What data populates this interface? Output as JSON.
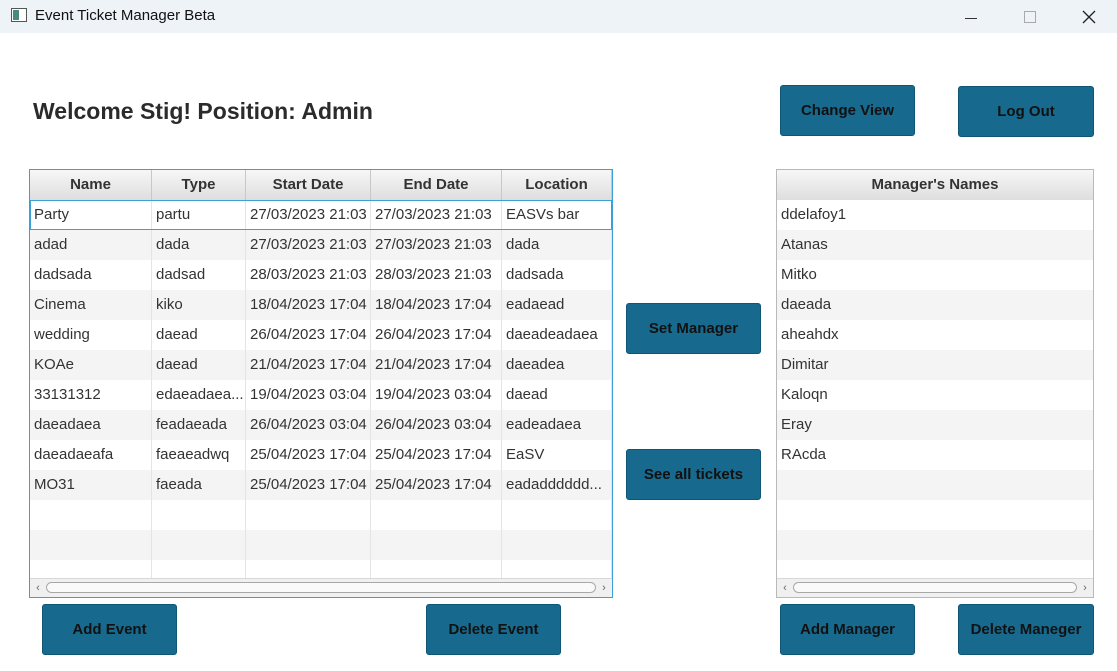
{
  "window": {
    "title": "Event Ticket Manager Beta"
  },
  "header": {
    "welcome": "Welcome Stig! Position: Admin"
  },
  "buttons": {
    "change_view": "Change View",
    "log_out": "Log Out",
    "set_manager": "Set Manager",
    "see_all_tickets": "See all tickets",
    "add_event": "Add Event",
    "delete_event": "Delete Event",
    "add_manager": "Add Manager",
    "delete_manager": "Delete Maneger"
  },
  "events_table": {
    "columns": [
      "Name",
      "Type",
      "Start Date",
      "End Date",
      "Location"
    ],
    "rows": [
      [
        "Party",
        "partu",
        "27/03/2023 21:03",
        "27/03/2023 21:03",
        "EASVs bar"
      ],
      [
        "adad",
        "dada",
        "27/03/2023 21:03",
        "27/03/2023 21:03",
        "dada"
      ],
      [
        "dadsada",
        "dadsad",
        "28/03/2023 21:03",
        "28/03/2023 21:03",
        "dadsada"
      ],
      [
        "Cinema",
        "kiko",
        "18/04/2023 17:04",
        "18/04/2023 17:04",
        "eadaead"
      ],
      [
        "wedding",
        "daead",
        "26/04/2023 17:04",
        "26/04/2023 17:04",
        "daeadeadaea"
      ],
      [
        "KOAe",
        "daead",
        "21/04/2023 17:04",
        "21/04/2023 17:04",
        "daeadea"
      ],
      [
        "33131312",
        "edaeadaea...",
        "19/04/2023 03:04",
        "19/04/2023 03:04",
        "daead"
      ],
      [
        "daeadaea",
        "feadaeada",
        "26/04/2023 03:04",
        "26/04/2023 03:04",
        "eadeadaea"
      ],
      [
        "daeadaeafa",
        "faeaeadwq",
        "25/04/2023 17:04",
        "25/04/2023 17:04",
        "EaSV"
      ],
      [
        "MO31",
        "faeada",
        "25/04/2023 17:04",
        "25/04/2023 17:04",
        "eadadddddd..."
      ]
    ]
  },
  "managers_table": {
    "column": "Manager's Names",
    "rows": [
      "ddelafoy1",
      "Atanas",
      "Mitko",
      "daeada",
      "aheahdx",
      "Dimitar",
      "Kaloqn",
      "Eray",
      "RAcda"
    ]
  },
  "colors": {
    "button": "#176a8e",
    "selection": "#3aa0d8"
  }
}
